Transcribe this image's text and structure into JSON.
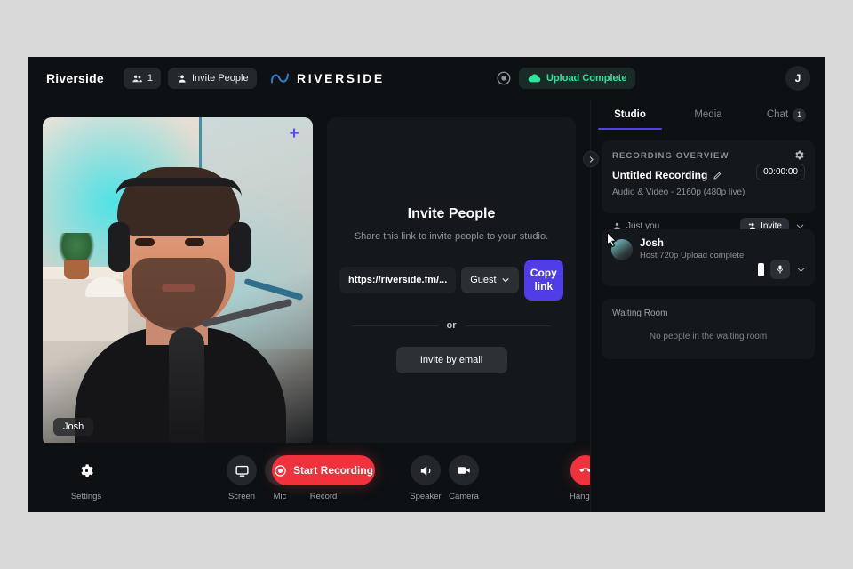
{
  "header": {
    "brand_name": "Riverside",
    "people_count_icon": "people-icon",
    "people_count": "1",
    "invite_people_icon": "person-add-icon",
    "invite_people_label": "Invite People",
    "logo_icon": "riverside-wave-icon",
    "logo_wordmark": "RIVERSIDE",
    "record_indicator_icon": "record-circle-icon",
    "upload_status_icon": "cloud-upload-icon",
    "upload_status_label": "Upload Complete",
    "upload_status_color": "#2ee59d",
    "avatar_initial": "J"
  },
  "stage": {
    "video_tile": {
      "add_icon": "plus-icon",
      "name_badge": "Josh"
    },
    "invite_panel": {
      "title": "Invite People",
      "subtitle": "Share this link to invite people to your studio.",
      "link_value": "https://riverside.fm/...",
      "link_placeholder": "https://riverside.fm/...",
      "role_value": "Guest",
      "role_chevron_icon": "chevron-down-icon",
      "copy_link_label": "Copy link",
      "copy_link_color": "#4f3de8",
      "or_label": "or",
      "invite_by_email_label": "Invite by email"
    }
  },
  "bottom_bar": {
    "settings_icon": "gear-icon",
    "settings_label": "Settings",
    "screen_icon": "monitor-icon",
    "screen_label": "Screen",
    "mic_icon": "microphone-icon",
    "mic_label": "Mic",
    "record_button_icon": "record-circle-icon",
    "record_button_label": "Start Recording",
    "record_label": "Record",
    "record_color": "#f0323c",
    "speaker_icon": "speaker-icon",
    "speaker_label": "Speaker",
    "camera_icon": "video-camera-icon",
    "camera_label": "Camera",
    "hangup_icon": "phone-hangup-icon",
    "hangup_label": "Hang up",
    "hangup_color": "#f0323c"
  },
  "sidebar": {
    "collapse_icon": "chevron-right-icon",
    "tabs": [
      {
        "label": "Studio",
        "badge": ""
      },
      {
        "label": "Media",
        "badge": ""
      },
      {
        "label": "Chat",
        "badge": "1"
      }
    ],
    "recording_overview": {
      "title": "RECORDING OVERVIEW",
      "settings_icon": "gear-icon",
      "name": "Untitled Recording",
      "edit_icon": "pencil-icon",
      "timer": "00:00:00",
      "quality": "Audio & Video - 2160p (480p live)",
      "participants_icon": "person-icon",
      "participants_label": "Just you",
      "invite_icon": "person-add-icon",
      "invite_label": "Invite",
      "chevron_icon": "chevron-down-icon"
    },
    "participant": {
      "avatar": "avatar-josh",
      "name": "Josh",
      "meta": "Host  720p  Upload complete",
      "level_meter_icon": "audio-level-icon",
      "mic_icon": "microphone-icon",
      "chevron_icon": "chevron-down-icon"
    },
    "waiting_room": {
      "title": "Waiting Room",
      "empty_message": "No people in the waiting room"
    }
  }
}
